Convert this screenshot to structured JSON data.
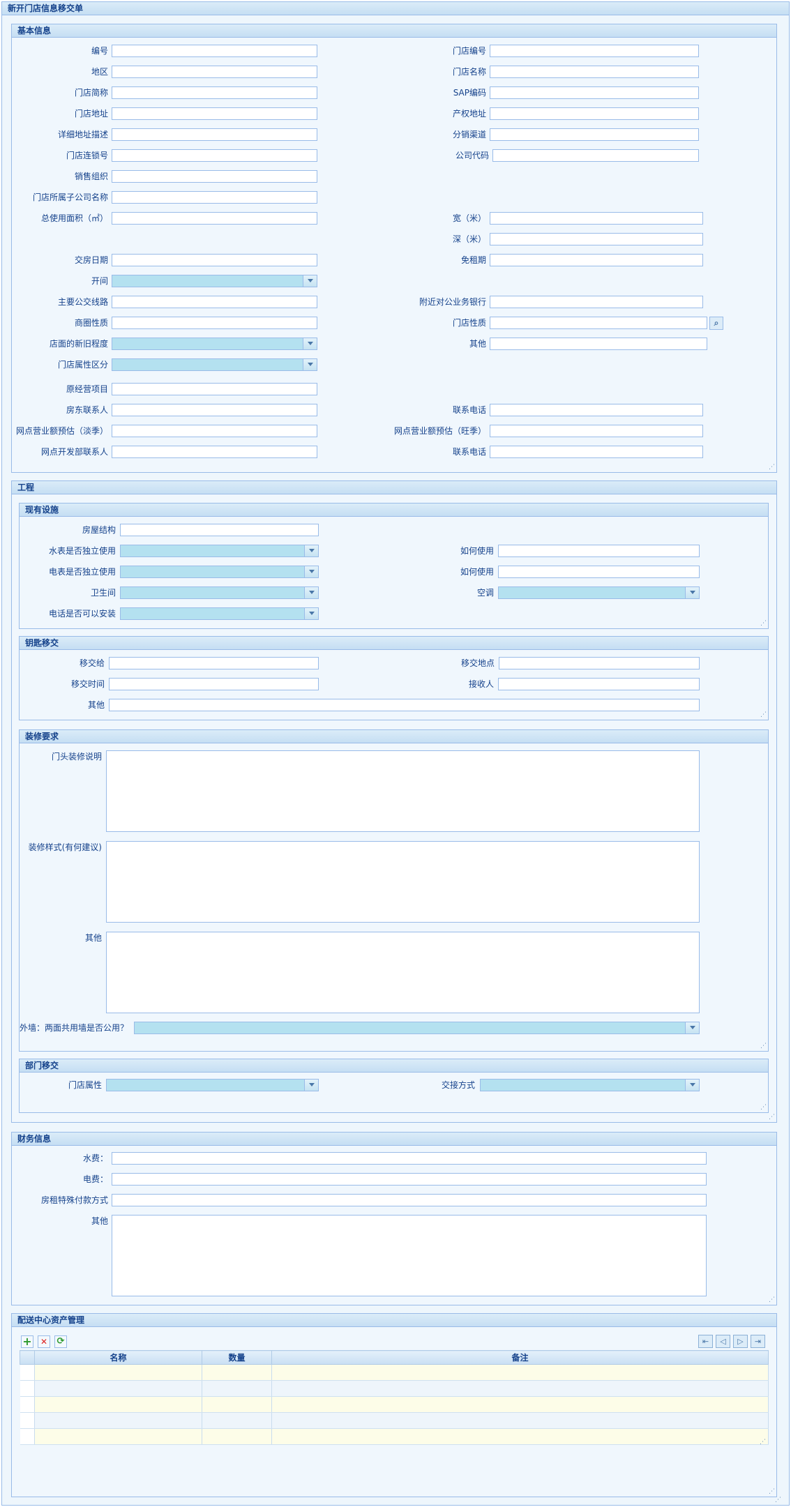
{
  "form_title": "新开门店信息移交单",
  "sections": {
    "basic": {
      "title": "基本信息",
      "labels": {
        "code": "编号",
        "store_code": "门店编号",
        "region": "地区",
        "store_name": "门店名称",
        "short_name": "门店简称",
        "sap_code": "SAP编码",
        "address": "门店地址",
        "property_address": "产权地址",
        "address_detail": "详细地址描述",
        "channel": "分销渠道",
        "chain_no": "门店连锁号",
        "company_code": "公司代码",
        "sales_org": "销售组织",
        "sub_company": "门店所属子公司名称",
        "total_area": "总使用面积（㎡）",
        "width": "宽（米）",
        "depth": "深（米）",
        "handover_date": "交房日期",
        "rent_free": "免租期",
        "opening": "开间",
        "bus_lines": "主要公交线路",
        "nearby_bank": "附近对公业务银行",
        "trade_area": "商圈性质",
        "store_nature": "门店性质",
        "old_new": "店面的新旧程度",
        "other": "其他",
        "attr_class": "门店属性区分",
        "prev_business": "原经营项目",
        "landlord_contact": "房东联系人",
        "phone1": "联系电话",
        "forecast_low": "网点营业额预估（淡季）",
        "forecast_high": "网点营业额预估（旺季）",
        "dev_contact": "网点开发部联系人",
        "phone2": "联系电话"
      }
    },
    "engineering": {
      "title": "工程",
      "facilities": {
        "title": "现有设施",
        "structure": "房屋结构",
        "water_meter": "水表是否独立使用",
        "how_use1": "如何使用",
        "elec_meter": "电表是否独立使用",
        "how_use2": "如何使用",
        "restroom": "卫生间",
        "aircon": "空调",
        "phone_install": "电话是否可以安装"
      },
      "keys": {
        "title": "钥匙移交",
        "handover_to": "移交给",
        "handover_place": "移交地点",
        "handover_time": "移交时间",
        "receiver": "接收人",
        "other": "其他"
      },
      "decoration": {
        "title": "装修要求",
        "facade": "门头装修说明",
        "style": "装修样式(有何建议)",
        "other": "其他",
        "wall": "外墙：两面共用墙是否公用？"
      },
      "dept": {
        "title": "部门移交",
        "store_attr": "门店属性",
        "handover_method": "交接方式"
      }
    },
    "finance": {
      "title": "财务信息",
      "water_fee": "水费：",
      "elec_fee": "电费：",
      "rent_payment": "房租特殊付款方式",
      "other": "其他"
    },
    "assets": {
      "title": "配送中心资产管理",
      "columns": [
        "名称",
        "数量",
        "备注"
      ],
      "toolbar": {
        "add": "+",
        "delete": "✕",
        "refresh": "⟳"
      },
      "nav": {
        "first": "⇤",
        "prev": "◁",
        "next": "▷",
        "last": "⇥"
      }
    }
  },
  "colors": {
    "accent": "#15428b",
    "panel_bg": "#eef6fc",
    "border": "#99bbe8",
    "select_bg": "#b4e1f0"
  }
}
